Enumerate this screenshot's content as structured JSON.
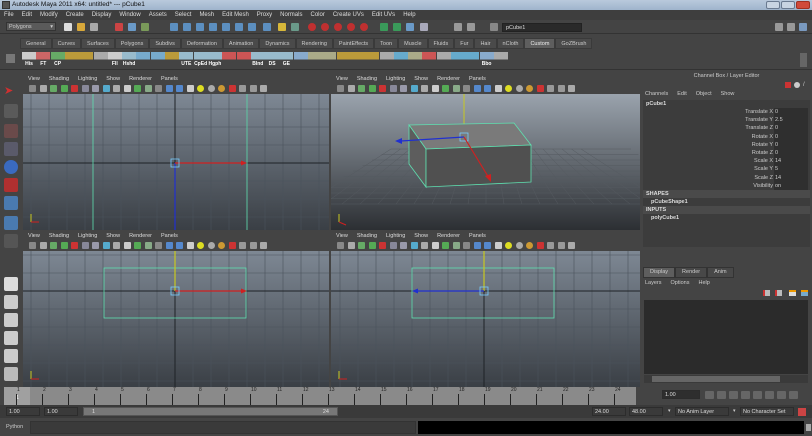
{
  "window": {
    "title": "Autodesk Maya 2011 x64: untitled*   ---   pCube1"
  },
  "menubar": [
    "File",
    "Edit",
    "Modify",
    "Create",
    "Display",
    "Window",
    "Assets",
    "Select",
    "Mesh",
    "Edit Mesh",
    "Proxy",
    "Normals",
    "Color",
    "Create UVs",
    "Edit UVs",
    "Help"
  ],
  "statusline": {
    "menu_set": "Polygons",
    "name_field": "pCube1"
  },
  "shelf": {
    "tabs": [
      "General",
      "Curves",
      "Surfaces",
      "Polygons",
      "Subdivs",
      "Deformation",
      "Animation",
      "Dynamics",
      "Rendering",
      "PaintEffects",
      "Toon",
      "Muscle",
      "Fluids",
      "Fur",
      "Hair",
      "nCloth",
      "Custom",
      "GoZBrush"
    ],
    "active_tab": "Custom",
    "icon_labels": [
      "His",
      "FT",
      "CP",
      "",
      "",
      "",
      "Fll",
      "Hshd",
      "",
      "",
      "",
      "UTE",
      "CpEd",
      "Hgph",
      "",
      "",
      "Blnd",
      "DS",
      "GE",
      "",
      "",
      "",
      "",
      "",
      "",
      "",
      "",
      "",
      "",
      "",
      "",
      "",
      "Bbo",
      ""
    ]
  },
  "panel_menu": [
    "View",
    "Shading",
    "Lighting",
    "Show",
    "Renderer",
    "Panels"
  ],
  "channel_box": {
    "header": "Channel Box / Layer Editor",
    "menu": [
      "Channels",
      "Edit",
      "Object",
      "Show"
    ],
    "object": "pCube1",
    "attributes": [
      {
        "name": "Translate X",
        "value": "0"
      },
      {
        "name": "Translate Y",
        "value": "2.5"
      },
      {
        "name": "Translate Z",
        "value": "0"
      },
      {
        "name": "Rotate X",
        "value": "0"
      },
      {
        "name": "Rotate Y",
        "value": "0"
      },
      {
        "name": "Rotate Z",
        "value": "0"
      },
      {
        "name": "Scale X",
        "value": "14"
      },
      {
        "name": "Scale Y",
        "value": "5"
      },
      {
        "name": "Scale Z",
        "value": "14"
      },
      {
        "name": "Visibility",
        "value": "on"
      }
    ],
    "shapes_label": "SHAPES",
    "shape": "pCubeShape1",
    "inputs_label": "INPUTS",
    "input": "polyCube1"
  },
  "layer_editor": {
    "tabs": [
      "Display",
      "Render",
      "Anim"
    ],
    "active_tab": "Display",
    "menu": [
      "Layers",
      "Options",
      "Help"
    ]
  },
  "time_slider": {
    "frames": [
      "1",
      "2",
      "3",
      "4",
      "5",
      "6",
      "7",
      "8",
      "9",
      "10",
      "11",
      "12",
      "13",
      "14",
      "15",
      "16",
      "17",
      "18",
      "19",
      "20",
      "21",
      "22",
      "23",
      "24"
    ],
    "current_frame_label": "1",
    "current_time": "1.00"
  },
  "range_slider": {
    "start_time": "1.00",
    "playback_start": "1.00",
    "range_start_label": "1",
    "range_end_label": "24",
    "playback_end": "24.00",
    "end_time": "48.00",
    "anim_layer": "No Anim Layer",
    "character_set": "No Character Set"
  },
  "command_line": {
    "language": "Python"
  },
  "colors": {
    "x_axis": "#d02020",
    "y_axis": "#c8c820",
    "z_axis": "#2030d0",
    "selection": "#5fe0b0",
    "title_bar": "#a9bdd4"
  }
}
